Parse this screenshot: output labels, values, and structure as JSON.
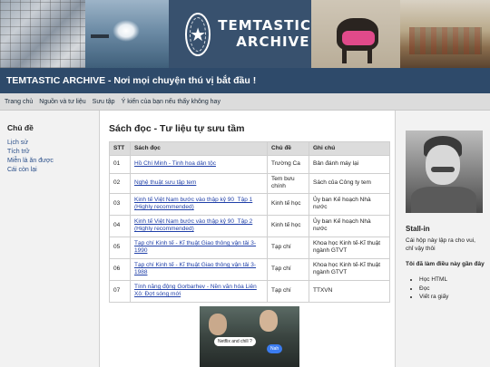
{
  "banner": {
    "logo_line1": "TEMTASTIC",
    "logo_line2": "ARCHIVE",
    "logo_icon": "star-seal-icon"
  },
  "site_title": "TEMTASTIC ARCHIVE - Nơi mọi chuyện thú vị bắt đầu !",
  "nav": {
    "items": [
      {
        "label": "Trang chủ"
      },
      {
        "label": "Nguồn và tư liệu"
      },
      {
        "label": "Sưu tập"
      },
      {
        "label": "Ý kiến của bạn nếu thấy không hay"
      }
    ]
  },
  "sidebar": {
    "title": "Chủ đề",
    "items": [
      {
        "label": "Lịch sử"
      },
      {
        "label": "Tích trữ"
      },
      {
        "label": "Miễn là ăn được"
      },
      {
        "label": "Cái còn lại"
      }
    ]
  },
  "main": {
    "title": "Sách đọc - Tư liệu tự sưu tầm",
    "table": {
      "headers": [
        "STT",
        "Sách đọc",
        "Chủ đề",
        "Ghi chú"
      ],
      "rows": [
        {
          "stt": "01",
          "book": "Hồ Chí Minh - Tinh hoa dân tộc",
          "topic": "Trường Ca",
          "note": "Bản đánh máy lại"
        },
        {
          "stt": "02",
          "book": "Nghệ thuật sưu tập tem",
          "topic": "Tem bưu chính",
          "note": "Sách của Công ty tem"
        },
        {
          "stt": "03",
          "book": "Kinh tế Việt Nam bước vào thập kỷ 90_Tập 1 (Highly recommended)",
          "topic": "Kinh tế học",
          "note": "Ủy ban Kế hoạch Nhà nước"
        },
        {
          "stt": "04",
          "book": "Kinh tế Việt Nam bước vào thập kỷ 90_Tập 2 (Highly recommended)",
          "topic": "Kinh tế học",
          "note": "Ủy ban Kế hoạch Nhà nước"
        },
        {
          "stt": "05",
          "book": "Tạp chí Kinh tế - Kĩ thuật Giao thông vận tải 3-1990",
          "topic": "Tạp chí",
          "note": "Khoa học Kinh tế-Kĩ thuật ngành GTVT"
        },
        {
          "stt": "06",
          "book": "Tạp chí Kinh tế - Kĩ thuật Giao thông vận tải 3-1988",
          "topic": "Tạp chí",
          "note": "Khoa học Kinh tế-Kĩ thuật ngành GTVT"
        },
        {
          "stt": "07",
          "book": "Tính năng động Gorbarhev - Nền văn hóa Liên Xô: Đợt sóng mới",
          "topic": "Tạp chí",
          "note": "TTXVN"
        }
      ]
    },
    "meme": {
      "bubble1": "Netflix and chill ?",
      "bubble2": "Nah"
    }
  },
  "right": {
    "name": "Stall-in",
    "quote": "Cái hộp này lập ra cho vui, chỉ vậy thôi",
    "learned_title": "Tôi đã làm điều này gần đây",
    "learned_items": [
      "Học HTML",
      "Đọc",
      "Viết ra giấy"
    ]
  }
}
